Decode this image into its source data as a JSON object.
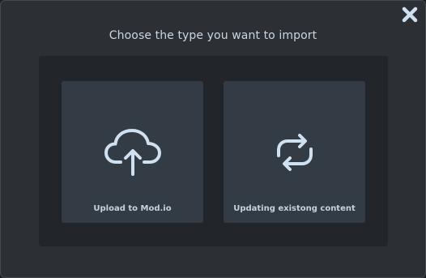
{
  "dialog": {
    "title": "Choose the type you want to import",
    "close_icon": "close-icon",
    "options": [
      {
        "label": "Upload to Mod.io",
        "icon": "cloud-upload-icon"
      },
      {
        "label": "Updating existong content",
        "icon": "refresh-icon"
      }
    ]
  },
  "colors": {
    "icon": "#cfe0f1",
    "card": "#333b45",
    "panel": "#22262a",
    "dialog": "#2c3035",
    "text": "#c6d3df"
  }
}
